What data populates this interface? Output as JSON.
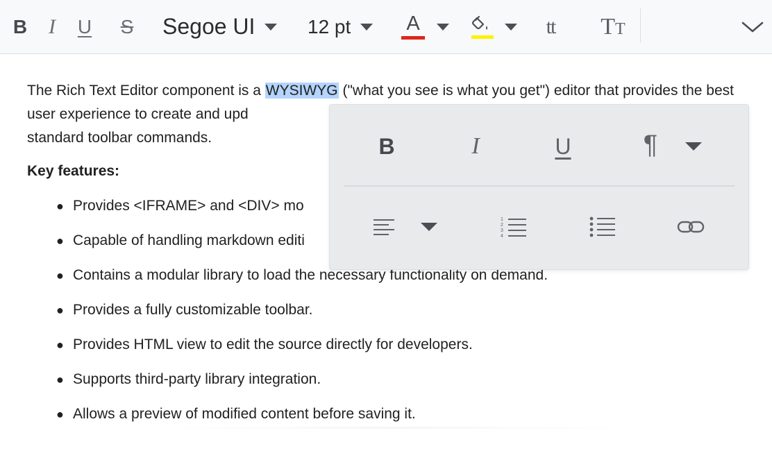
{
  "toolbar": {
    "bold": "B",
    "italic": "I",
    "underline": "U",
    "strikethrough": "S",
    "font_name": "Segoe UI",
    "font_size": "12 pt",
    "font_color_glyph": "A",
    "font_color": "#e1251b",
    "background_color": "#fff200",
    "lowercase": "tt",
    "uppercase": "TT",
    "icons": [
      "bold-icon",
      "italic-icon",
      "underline-icon",
      "strikethrough-icon",
      "font-color-icon",
      "background-color-icon",
      "lowercase-icon",
      "uppercase-icon",
      "expand-more-icon"
    ]
  },
  "content": {
    "intro_before": "The Rich Text Editor component is a ",
    "intro_highlight": "WYSIWYG",
    "intro_after": " (\"what you see is what you get\") editor that provides the best user experience to create and upd",
    "intro_line3": "standard toolbar commands.",
    "key_heading": "Key features:",
    "features": [
      "Provides <IFRAME> and <DIV> mo",
      "Capable of handling markdown editi",
      "Contains a modular library to load the necessary functionality on demand.",
      "Provides a fully customizable toolbar.",
      "Provides HTML view to edit the source directly for developers.",
      "Supports third-party library integration.",
      "Allows a preview of modified content before saving it."
    ],
    "highlight_color": "#b3d4fc"
  },
  "quick_toolbar": {
    "bold": "B",
    "italic": "I",
    "underline": "U",
    "paragraph": "¶",
    "icons": [
      "bold-icon",
      "italic-icon",
      "underline-icon",
      "paragraph-format-icon",
      "alignment-icon",
      "ordered-list-icon",
      "unordered-list-icon",
      "link-icon"
    ]
  }
}
